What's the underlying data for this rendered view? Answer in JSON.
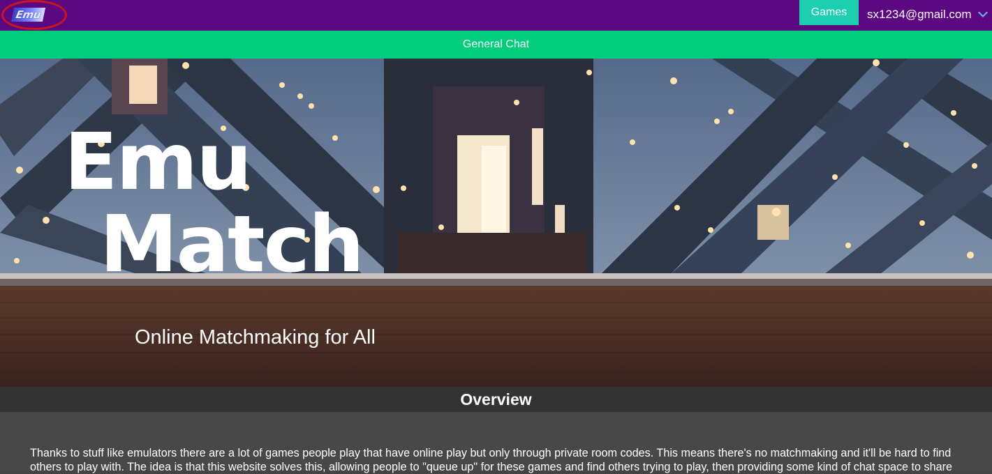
{
  "nav": {
    "logo_text": "Emu",
    "games_label": "Games",
    "user_email": "sx1234@gmail.com",
    "user_menu_icon": "chevron-down-icon"
  },
  "chat": {
    "label": "General Chat"
  },
  "hero": {
    "title_line1": "Emu",
    "title_line2": "Match",
    "subtitle": "Online Matchmaking for All"
  },
  "overview": {
    "heading": "Overview",
    "body": "Thanks to stuff like emulators there are a lot of games people play that have online play but only through private room codes. This means there's no matchmaking and it'll be hard to find others to play with. The idea is that this website solves this, allowing people to \"queue up\" for these games and find others trying to play, then providing some kind of chat space to share"
  },
  "colors": {
    "nav_bg": "#5c0880",
    "games_btn": "#1ccfb0",
    "chat_bar": "#00ce7c",
    "overview_bar": "#333333",
    "content_bg": "#484848"
  }
}
